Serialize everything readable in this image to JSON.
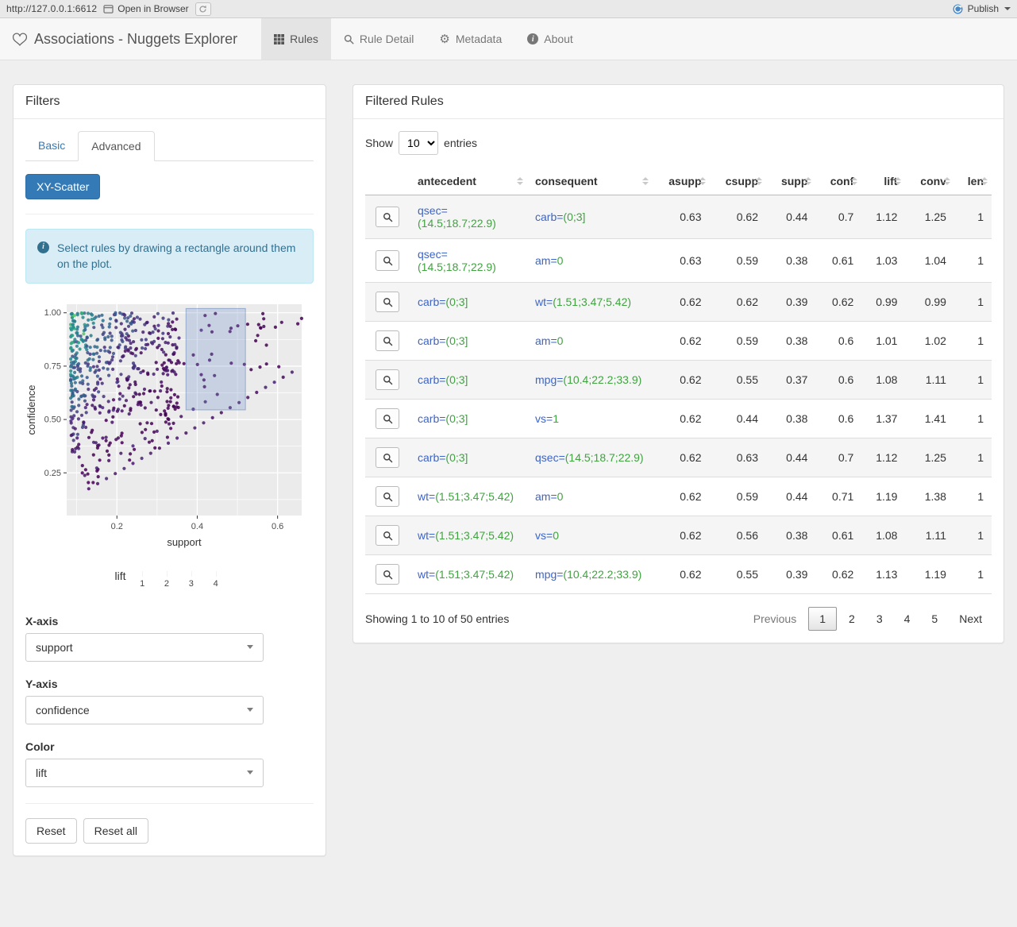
{
  "topbar": {
    "url": "http://127.0.0.1:6612",
    "open_in_browser": "Open in Browser",
    "publish_label": "Publish"
  },
  "navbar": {
    "title": "Associations - Nuggets Explorer",
    "tabs": [
      {
        "label": "Rules",
        "icon": "table-icon",
        "active": true
      },
      {
        "label": "Rule Detail",
        "icon": "search-icon",
        "active": false
      },
      {
        "label": "Metadata",
        "icon": "gear-icon",
        "active": false
      },
      {
        "label": "About",
        "icon": "info-icon",
        "active": false
      }
    ]
  },
  "filters": {
    "title": "Filters",
    "tabs": [
      {
        "label": "Basic",
        "active": false
      },
      {
        "label": "Advanced",
        "active": true
      }
    ],
    "scatter_button_label": "XY-Scatter",
    "info_text": "Select rules by drawing a rectangle around them on the plot.",
    "x_axis": {
      "label": "X-axis",
      "value": "support"
    },
    "y_axis": {
      "label": "Y-axis",
      "value": "confidence"
    },
    "color": {
      "label": "Color",
      "value": "lift"
    },
    "reset_label": "Reset",
    "reset_all_label": "Reset all"
  },
  "chart_data": {
    "type": "scatter",
    "xlabel": "support",
    "ylabel": "confidence",
    "x_ticks": [
      {
        "v": 0.2,
        "label": "0.2"
      },
      {
        "v": 0.4,
        "label": "0.4"
      },
      {
        "v": 0.6,
        "label": "0.6"
      }
    ],
    "x_minor": [
      0.1,
      0.3,
      0.5
    ],
    "y_ticks": [
      {
        "v": 0.25,
        "label": "0.25"
      },
      {
        "v": 0.5,
        "label": "0.50"
      },
      {
        "v": 0.75,
        "label": "0.75"
      },
      {
        "v": 1.0,
        "label": "1.00"
      }
    ],
    "y_minor": [
      0.125,
      0.375,
      0.625,
      0.875
    ],
    "xlim": [
      0.075,
      0.66
    ],
    "ylim": [
      0.05,
      1.04
    ],
    "grid": true,
    "color_legend": {
      "label": "lift",
      "ticks": [
        {
          "v": 1,
          "label": "1"
        },
        {
          "v": 2,
          "label": "2"
        },
        {
          "v": 3,
          "label": "3"
        },
        {
          "v": 4,
          "label": "4"
        }
      ],
      "range": [
        0.72,
        4.35
      ],
      "palette": "viridis",
      "position": "bottom"
    },
    "selection_rect": {
      "x0": 0.372,
      "x1": 0.52,
      "y0": 0.545,
      "y1": 1.02
    },
    "points": {
      "n": 560,
      "seed": 1234,
      "tail_prob": 0.08
    },
    "streaks": [
      {
        "slope": 1.08,
        "intercept": 0.035,
        "s0": 0.13,
        "s1": 0.655,
        "step": 0.022
      },
      {
        "slope": 1.15,
        "intercept": 0.1,
        "s0": 0.12,
        "s1": 0.46,
        "step": 0.03
      }
    ]
  },
  "rules_panel": {
    "title": "Filtered Rules",
    "length_control": {
      "show_label": "Show",
      "value": "10",
      "entries_label": "entries"
    },
    "columns": [
      "antecedent",
      "consequent",
      "asupp",
      "csupp",
      "supp",
      "conf",
      "lift",
      "conv",
      "len"
    ],
    "rows": [
      {
        "antecedent": {
          "name": "qsec=",
          "value": "(14.5;18.7;22.9)"
        },
        "consequent": {
          "name": "carb=",
          "value": "(0;3]"
        },
        "asupp": "0.63",
        "csupp": "0.62",
        "supp": "0.44",
        "conf": "0.7",
        "lift": "1.12",
        "conv": "1.25",
        "len": "1"
      },
      {
        "antecedent": {
          "name": "qsec=",
          "value": "(14.5;18.7;22.9)"
        },
        "consequent": {
          "name": "am=",
          "value": "0"
        },
        "asupp": "0.63",
        "csupp": "0.59",
        "supp": "0.38",
        "conf": "0.61",
        "lift": "1.03",
        "conv": "1.04",
        "len": "1"
      },
      {
        "antecedent": {
          "name": "carb=",
          "value": "(0;3]"
        },
        "consequent": {
          "name": "wt=",
          "value": "(1.51;3.47;5.42)"
        },
        "asupp": "0.62",
        "csupp": "0.62",
        "supp": "0.39",
        "conf": "0.62",
        "lift": "0.99",
        "conv": "0.99",
        "len": "1"
      },
      {
        "antecedent": {
          "name": "carb=",
          "value": "(0;3]"
        },
        "consequent": {
          "name": "am=",
          "value": "0"
        },
        "asupp": "0.62",
        "csupp": "0.59",
        "supp": "0.38",
        "conf": "0.6",
        "lift": "1.01",
        "conv": "1.02",
        "len": "1"
      },
      {
        "antecedent": {
          "name": "carb=",
          "value": "(0;3]"
        },
        "consequent": {
          "name": "mpg=",
          "value": "(10.4;22.2;33.9)"
        },
        "asupp": "0.62",
        "csupp": "0.55",
        "supp": "0.37",
        "conf": "0.6",
        "lift": "1.08",
        "conv": "1.11",
        "len": "1"
      },
      {
        "antecedent": {
          "name": "carb=",
          "value": "(0;3]"
        },
        "consequent": {
          "name": "vs=",
          "value": "1"
        },
        "asupp": "0.62",
        "csupp": "0.44",
        "supp": "0.38",
        "conf": "0.6",
        "lift": "1.37",
        "conv": "1.41",
        "len": "1"
      },
      {
        "antecedent": {
          "name": "carb=",
          "value": "(0;3]"
        },
        "consequent": {
          "name": "qsec=",
          "value": "(14.5;18.7;22.9)"
        },
        "asupp": "0.62",
        "csupp": "0.63",
        "supp": "0.44",
        "conf": "0.7",
        "lift": "1.12",
        "conv": "1.25",
        "len": "1"
      },
      {
        "antecedent": {
          "name": "wt=",
          "value": "(1.51;3.47;5.42)"
        },
        "consequent": {
          "name": "am=",
          "value": "0"
        },
        "asupp": "0.62",
        "csupp": "0.59",
        "supp": "0.44",
        "conf": "0.71",
        "lift": "1.19",
        "conv": "1.38",
        "len": "1"
      },
      {
        "antecedent": {
          "name": "wt=",
          "value": "(1.51;3.47;5.42)"
        },
        "consequent": {
          "name": "vs=",
          "value": "0"
        },
        "asupp": "0.62",
        "csupp": "0.56",
        "supp": "0.38",
        "conf": "0.61",
        "lift": "1.08",
        "conv": "1.11",
        "len": "1"
      },
      {
        "antecedent": {
          "name": "wt=",
          "value": "(1.51;3.47;5.42)"
        },
        "consequent": {
          "name": "mpg=",
          "value": "(10.4;22.2;33.9)"
        },
        "asupp": "0.62",
        "csupp": "0.55",
        "supp": "0.39",
        "conf": "0.62",
        "lift": "1.13",
        "conv": "1.19",
        "len": "1"
      }
    ],
    "footer": {
      "info": "Showing 1 to 10 of 50 entries",
      "previous_label": "Previous",
      "pages": [
        "1",
        "2",
        "3",
        "4",
        "5"
      ],
      "active_page": "1",
      "next_label": "Next"
    }
  }
}
